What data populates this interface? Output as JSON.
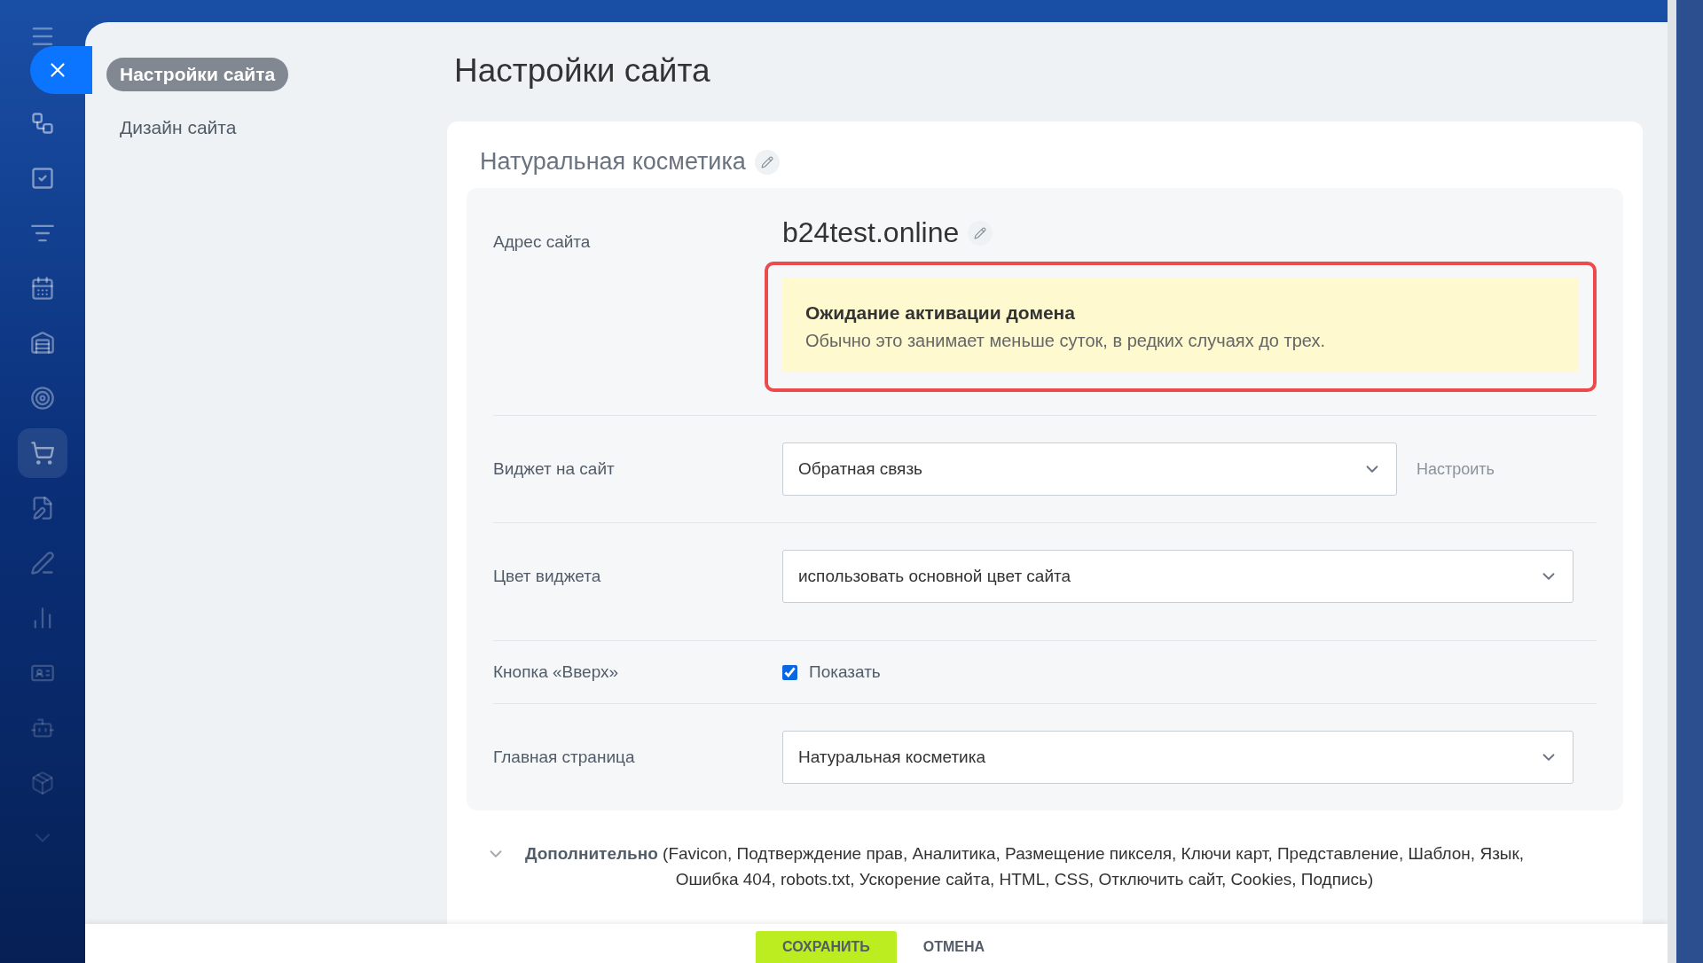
{
  "nav_items": [
    {
      "selected": false
    },
    {
      "selected": false
    },
    {
      "selected": false
    },
    {
      "selected": false
    },
    {
      "selected": false
    },
    {
      "selected": false
    },
    {
      "selected": true
    },
    {
      "selected": false
    },
    {
      "selected": false
    },
    {
      "selected": false
    },
    {
      "selected": false
    },
    {
      "selected": false
    },
    {
      "selected": false
    },
    {
      "selected": false
    }
  ],
  "side_menu": [
    {
      "label": "Настройки сайта",
      "selected": true
    },
    {
      "label": "Дизайн сайта",
      "selected": false
    }
  ],
  "page_title": "Настройки сайта",
  "site_name": "Натуральная косметика",
  "rows": [
    {
      "kind": "address",
      "label": "Адрес сайта",
      "value": "b24test.online",
      "alert": {
        "title": "Ожидание активации домена",
        "text": "Обычно это занимает меньше суток, в редких случаях до трех."
      }
    },
    {
      "kind": "select",
      "label": "Виджет на сайт",
      "value": "Обратная связь",
      "action": "Настроить"
    },
    {
      "kind": "select",
      "label": "Цвет виджета",
      "value": "использовать основной цвет сайта"
    },
    {
      "kind": "checkbox",
      "label": "Кнопка «Вверх»",
      "option": "Показать",
      "checked": true
    },
    {
      "kind": "select",
      "label": "Главная страница",
      "value": "Натуральная косметика"
    }
  ],
  "additional": {
    "expanded": false,
    "text": "**Дополнительно** (Favicon,  Подтверждение прав,  Аналитика,  Размещение пикселя,  Ключи карт,  Представление,  Шаблон,  Язык,  Ошибка 404,  robots.txt,  Ускорение сайта,  HTML,  CSS,  Отключить сайт,  Cookies,  Подпись)"
  },
  "buttons": [
    {
      "kind": "primary",
      "label": "СОХРАНИТЬ"
    },
    {
      "kind": "link",
      "label": "ОТМЕНА"
    }
  ]
}
